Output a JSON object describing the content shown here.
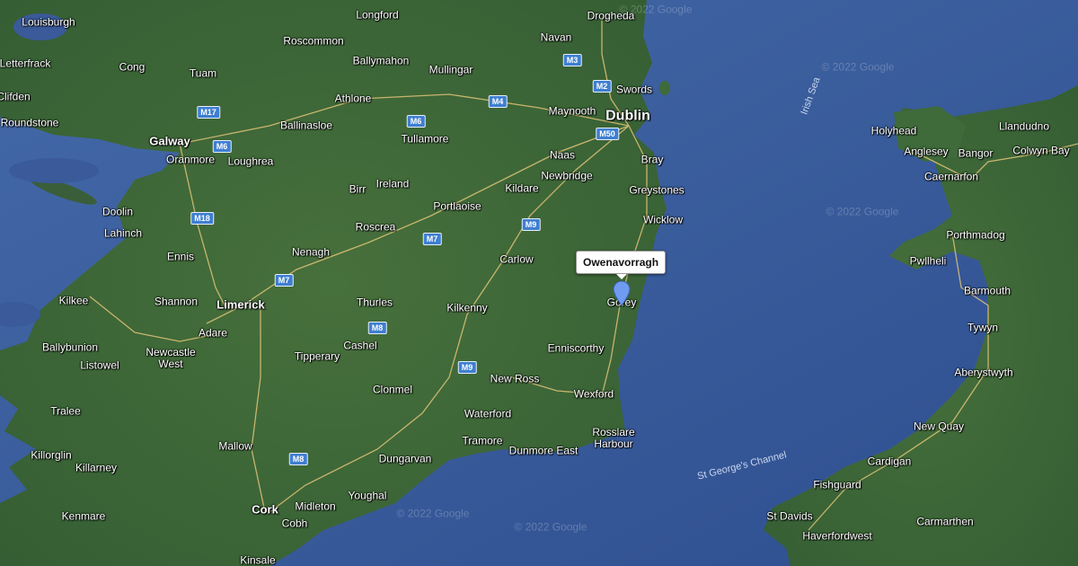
{
  "places": {
    "louisburgh": "Louisburgh",
    "longford": "Longford",
    "drogheda": "Drogheda",
    "roscommon": "Roscommon",
    "navan": "Navan",
    "letterfrack": "Letterfrack",
    "cong": "Cong",
    "ballymahon": "Ballymahon",
    "mullingar": "Mullingar",
    "tuam": "Tuam",
    "swords": "Swords",
    "clifden": "Clifden",
    "athlone": "Athlone",
    "maynooth": "Maynooth",
    "dublin": "Dublin",
    "roundstone": "Roundstone",
    "ballinasloe": "Ballinasloe",
    "galway": "Galway",
    "tullamore": "Tullamore",
    "oranmore": "Oranmore",
    "loughrea": "Loughrea",
    "naas": "Naas",
    "bray": "Bray",
    "newbridge": "Newbridge",
    "ireland": "Ireland",
    "birr": "Birr",
    "kildare": "Kildare",
    "greystones": "Greystones",
    "doolin": "Doolin",
    "portlaoise": "Portlaoise",
    "wicklow": "Wicklow",
    "lahinch": "Lahinch",
    "roscrea": "Roscrea",
    "nenagh": "Nenagh",
    "ennis": "Ennis",
    "carlow": "Carlow",
    "kilkee": "Kilkee",
    "shannon": "Shannon",
    "limerick": "Limerick",
    "thurles": "Thurles",
    "kilkenny": "Kilkenny",
    "gorey": "Gorey",
    "adare": "Adare",
    "ballybunion": "Ballybunion",
    "newcastle_west": "Newcastle\nWest",
    "cashel": "Cashel",
    "enniscorthy": "Enniscorthy",
    "tipperary": "Tipperary",
    "listowel": "Listowel",
    "new_ross": "New Ross",
    "clonmel": "Clonmel",
    "wexford": "Wexford",
    "tralee": "Tralee",
    "waterford": "Waterford",
    "rosslare": "Rosslare\nHarbour",
    "tramore": "Tramore",
    "dunmore_east": "Dunmore East",
    "mallow": "Mallow",
    "killorglin": "Killorglin",
    "dungarvan": "Dungarvan",
    "killarney": "Killarney",
    "youghal": "Youghal",
    "midleton": "Midleton",
    "cork": "Cork",
    "kenmare": "Kenmare",
    "cobh": "Cobh",
    "kinsale": "Kinsale",
    "holyhead": "Holyhead",
    "llandudno": "Llandudno",
    "anglesey": "Anglesey",
    "bangor": "Bangor",
    "colwyn_bay": "Colwyn Bay",
    "caernarfon": "Caernarfon",
    "porthmadog": "Porthmadog",
    "pwllheli": "Pwllheli",
    "barmouth": "Barmouth",
    "tywyn": "Tywyn",
    "aberystwyth": "Aberystwyth",
    "new_quay": "New Quay",
    "cardigan": "Cardigan",
    "fishguard": "Fishguard",
    "st_davids": "St Davids",
    "carmarthen": "Carmarthen",
    "haverfordwest": "Haverfordwest"
  },
  "seas": {
    "irish_sea": "Irish Sea",
    "st_georges": "St George's Channel"
  },
  "roads": {
    "m3": "M3",
    "m2": "M2",
    "m4": "M4",
    "m17": "M17",
    "m6a": "M6",
    "m6b": "M6",
    "m50": "M50",
    "m18": "M18",
    "m9a": "M9",
    "m9b": "M9",
    "m7a": "M7",
    "m7b": "M7",
    "m8a": "M8",
    "m8b": "M8"
  },
  "watermark": "© 2022 Google",
  "marker": {
    "label": "Owenavorragh",
    "color": "#6f9bf0"
  },
  "colors": {
    "sea": "#3a5a9a",
    "land": "#3f6a3a",
    "road": "#e9c97a"
  }
}
